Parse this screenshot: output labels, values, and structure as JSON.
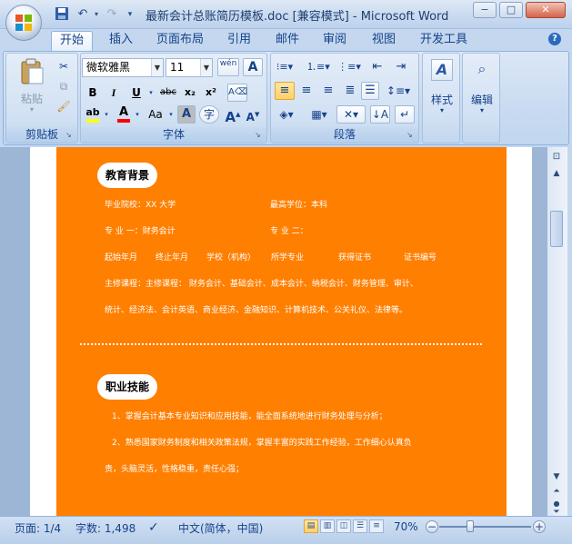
{
  "window": {
    "title": "最新会计总账简历模板.doc [兼容模式] - Microsoft Word",
    "min": "−",
    "max": "□",
    "close": "✕"
  },
  "qat": {
    "save_icon": "save-icon",
    "undo_icon": "undo-icon",
    "redo_icon": "redo-icon",
    "customize_icon": "dropdown-icon"
  },
  "tabs": [
    "开始",
    "插入",
    "页面布局",
    "引用",
    "邮件",
    "审阅",
    "视图",
    "开发工具"
  ],
  "help": "?",
  "clipboard": {
    "paste_label": "粘贴",
    "group_label": "剪贴板"
  },
  "font": {
    "name": "微软雅黑",
    "size": "11",
    "phonetic": "wén",
    "bold": "B",
    "italic": "I",
    "underline": "U",
    "strike": "abc",
    "subscript": "x₂",
    "superscript": "x²",
    "case": "Aa",
    "grow": "A",
    "shrink": "A",
    "group_label": "字体"
  },
  "paragraph": {
    "group_label": "段落"
  },
  "styles": {
    "label": "样式"
  },
  "editing": {
    "label": "编辑"
  },
  "document": {
    "edu_heading": "教育背景",
    "edu_school": "毕业院校：XX 大学",
    "edu_degree": "最高学位：本科",
    "edu_major1": "专  业  一：财务会计",
    "edu_major2": "专  业  二：",
    "edu_cols": [
      "起始年月",
      "终止年月",
      "学校（机构）",
      "所学专业",
      "获得证书",
      "证书编号"
    ],
    "edu_courses_1": "主修课程：主修课程：  财务会计、基础会计、成本会计、纳税会计、财务管理、审计、",
    "edu_courses_2": "统计、经济法、会计英语、商业经济、金融知识、计算机技术、公关礼仪、法律等。",
    "skill_heading": "职业技能",
    "skill_1": "1、掌握会计基本专业知识和应用技能，能全面系统地进行财务处理与分析；",
    "skill_2": "2、熟悉国家财务制度和相关政策法规，掌握丰富的实践工作经验，工作细心认真负",
    "skill_3": "责，头脑灵活，性格稳重，责任心强；"
  },
  "status": {
    "page": "页面: 1/4",
    "words": "字数: 1,498",
    "language": "中文(简体，中国)",
    "zoom": "70%",
    "zoom_minus": "−",
    "zoom_plus": "+"
  },
  "colors": {
    "accent": "#ff7f00",
    "ribbon": "#c4d7ee",
    "highlight": "#ffff00",
    "font_color": "#ff0000"
  }
}
